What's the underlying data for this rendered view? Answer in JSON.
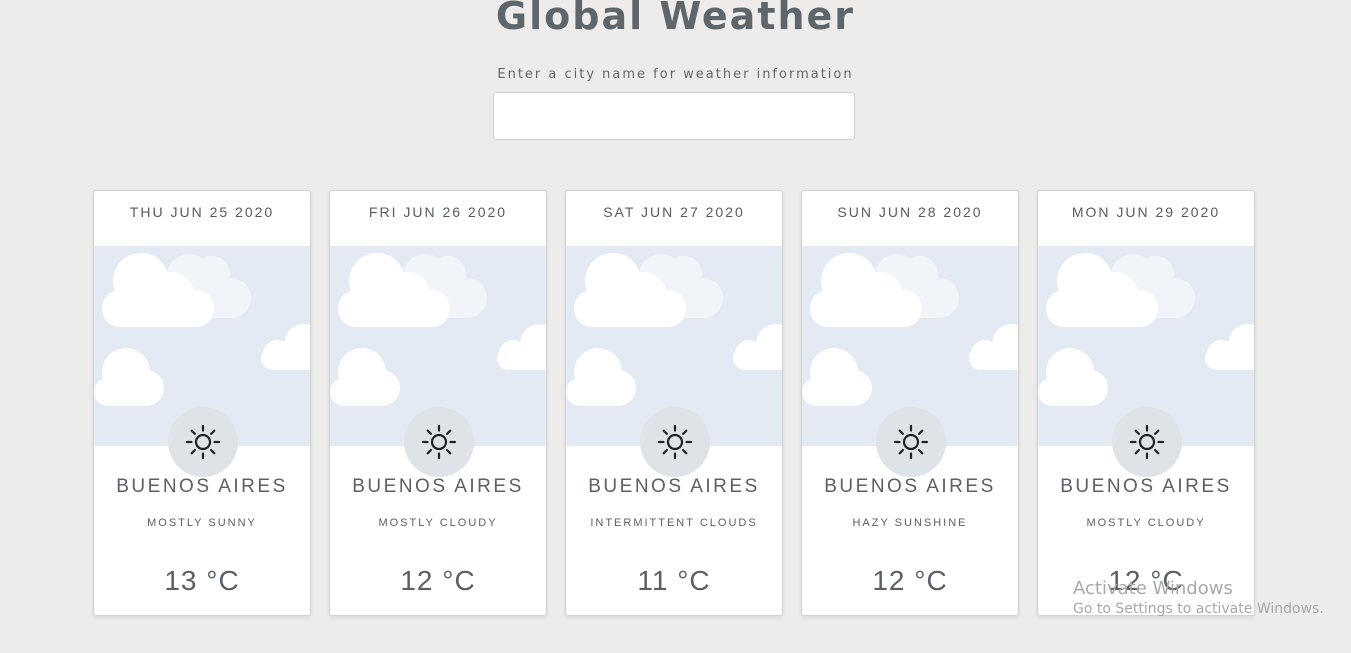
{
  "header": {
    "title": "Global Weather",
    "prompt": "Enter a city name for weather information"
  },
  "search": {
    "value": "",
    "placeholder": ""
  },
  "forecast": [
    {
      "date": "THU JUN 25 2020",
      "city": "BUENOS AIRES",
      "condition": "MOSTLY SUNNY",
      "temp": "13 °C",
      "icon": "sun-icon"
    },
    {
      "date": "FRI JUN 26 2020",
      "city": "BUENOS AIRES",
      "condition": "MOSTLY CLOUDY",
      "temp": "12 °C",
      "icon": "sun-icon"
    },
    {
      "date": "SAT JUN 27 2020",
      "city": "BUENOS AIRES",
      "condition": "INTERMITTENT CLOUDS",
      "temp": "11 °C",
      "icon": "sun-icon"
    },
    {
      "date": "SUN JUN 28 2020",
      "city": "BUENOS AIRES",
      "condition": "HAZY SUNSHINE",
      "temp": "12 °C",
      "icon": "sun-icon"
    },
    {
      "date": "MON JUN 29 2020",
      "city": "BUENOS AIRES",
      "condition": "MOSTLY CLOUDY",
      "temp": "12 °C",
      "icon": "sun-icon"
    }
  ],
  "watermark": {
    "title": "Activate Windows",
    "subtitle": "Go to Settings to activate Windows."
  },
  "colors": {
    "background": "#edecea",
    "sky": "#e4eaf4",
    "cloud": "#ffffff",
    "icon_circle": "#dde3e6",
    "text": "#5a6066"
  }
}
